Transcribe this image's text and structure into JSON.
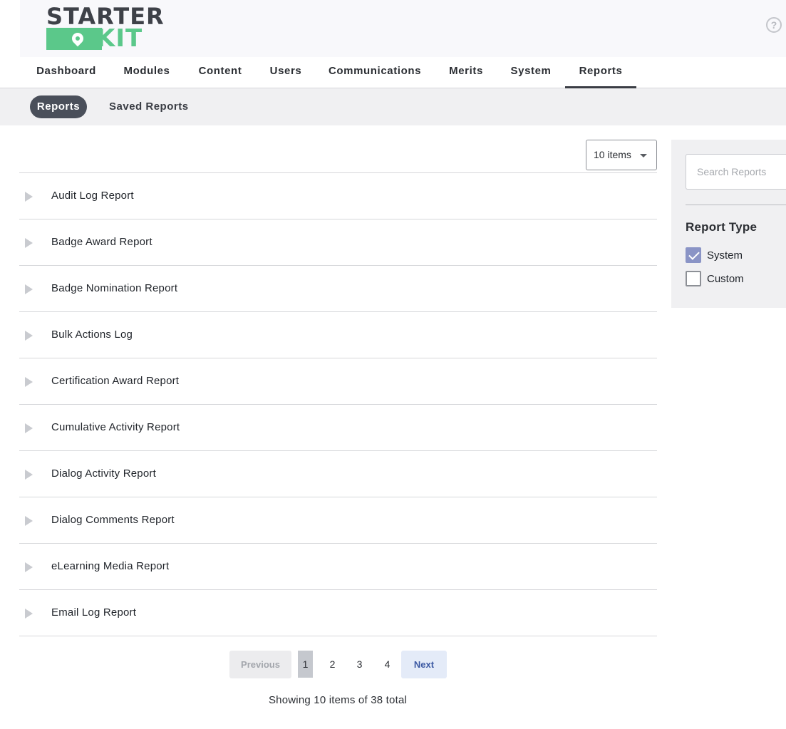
{
  "header": {
    "logo_top": "STARTER",
    "logo_bottom": "KIT",
    "help_icon": "?"
  },
  "main_nav": {
    "items": [
      "Dashboard",
      "Modules",
      "Content",
      "Users",
      "Communications",
      "Merits",
      "System",
      "Reports"
    ],
    "active": "Reports"
  },
  "sub_nav": {
    "active": "Reports",
    "other": "Saved Reports"
  },
  "items_select": {
    "value": "10 items"
  },
  "reports": [
    "Audit Log Report",
    "Badge Award Report",
    "Badge Nomination Report",
    "Bulk Actions Log",
    "Certification Award Report",
    "Cumulative Activity Report",
    "Dialog Activity Report",
    "Dialog Comments Report",
    "eLearning Media Report",
    "Email Log Report"
  ],
  "pagination": {
    "previous": "Previous",
    "pages": [
      "1",
      "2",
      "3",
      "4"
    ],
    "current": "1",
    "next": "Next",
    "summary": "Showing 10 items of 38 total"
  },
  "filters": {
    "search_placeholder": "Search Reports",
    "title": "Report Type",
    "options": [
      {
        "label": "System",
        "checked": true
      },
      {
        "label": "Custom",
        "checked": false
      }
    ]
  },
  "colors": {
    "accent_green": "#5bc88a",
    "pill_bg": "#4a4f5a",
    "checkbox_checked": "#8a94c6",
    "next_text": "#3d5aa3"
  }
}
